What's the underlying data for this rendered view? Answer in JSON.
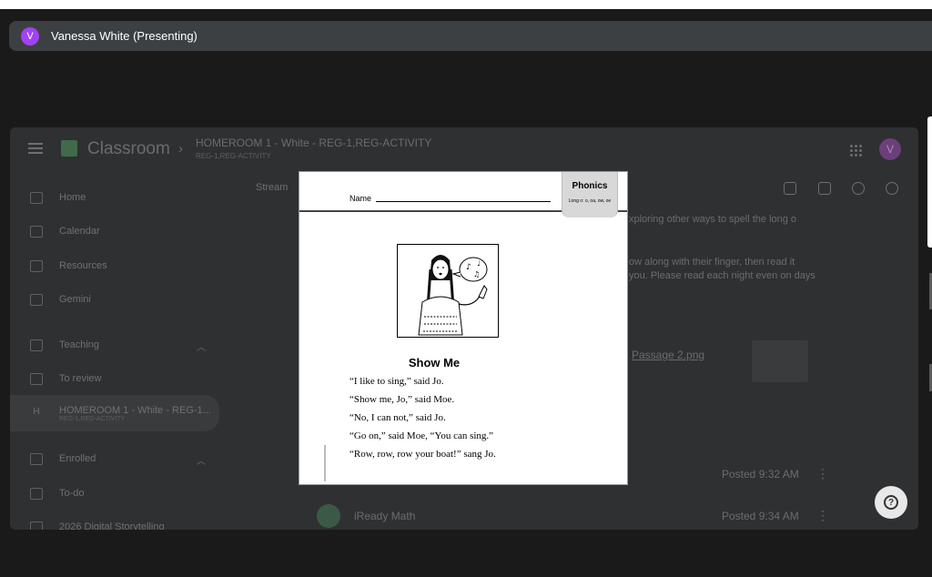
{
  "presenter": {
    "avatar_letter": "V",
    "name": "Vanessa White (Presenting)"
  },
  "classroom": {
    "app_title": "Classroom",
    "course_title": "HOMEROOM 1 - White - REG-1,REG-ACTIVITY",
    "course_subtitle": "REG-1,REG-ACTIVITY",
    "user_avatar_letter": "V",
    "stream_tab": "Stream",
    "sidebar": {
      "home": "Home",
      "calendar": "Calendar",
      "resources": "Resources",
      "gemini": "Gemini",
      "teaching": "Teaching",
      "to_review": "To review",
      "homeroom_item": "HOMEROOM 1 - White - REG-1...",
      "homeroom_item_sub": "REG-1,REG-ACTIVITY",
      "homeroom_badge": "H",
      "enrolled": "Enrolled",
      "to_do": "To-do",
      "digital_storytelling": "2026 Digital Storytelling"
    },
    "stream": {
      "card_text_1": "xploring other ways to spell the long o",
      "card_text_2": "ow along with their finger, then read it",
      "card_text_3": "you. Please read each night even on days",
      "attachment_label": "Passage 2.png",
      "posted_1": "Posted 9:32 AM",
      "post_2_title": "iReady Math",
      "posted_2": "Posted 9:34 AM"
    }
  },
  "worksheet": {
    "name_label": "Name",
    "tab_title": "Phonics",
    "tab_subtitle": "Long o: o, oa, ow, oe",
    "story_title": "Show Me",
    "lines": [
      "“I like to sing,” said Jo.",
      "“Show me, Jo,” said Moe.",
      "“No, I can not,” said Jo.",
      "“Go on,” said Moe, “You can sing.”",
      "“Row, row, row your boat!” sang Jo."
    ]
  },
  "icons": {
    "help": "help-circle-icon",
    "apps": "apps-grid-icon",
    "menu": "hamburger-menu-icon"
  },
  "colors": {
    "presenter_avatar": "#a142f4",
    "presenter_bar": "#3c4043",
    "background": "#1a1a1a",
    "classroom_dimmed": "#2f3031"
  }
}
